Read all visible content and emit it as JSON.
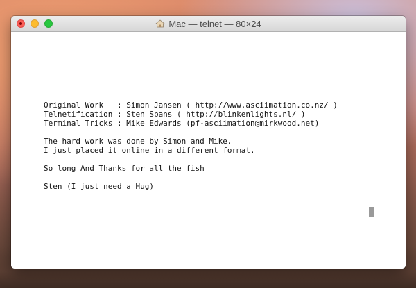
{
  "window": {
    "title": "Mac — telnet — 80×24"
  },
  "terminal": {
    "lines": [
      "Original Work   : Simon Jansen ( http://www.asciimation.co.nz/ )",
      "Telnetification : Sten Spans ( http://blinkenlights.nl/ )",
      "Terminal Tricks : Mike Edwards (pf-asciimation@mirkwood.net)",
      "",
      "The hard work was done by Simon and Mike,",
      "I just placed it online in a different format.",
      "",
      "So long And Thanks for all the fish",
      "",
      "Sten (I just need a Hug)"
    ]
  },
  "colors": {
    "close": "#fc5f57",
    "minimize": "#fdbc2e",
    "zoom": "#28c840",
    "terminal_bg": "#ffffff",
    "terminal_fg": "#111111"
  },
  "icons": {
    "title_icon": "house-icon"
  }
}
